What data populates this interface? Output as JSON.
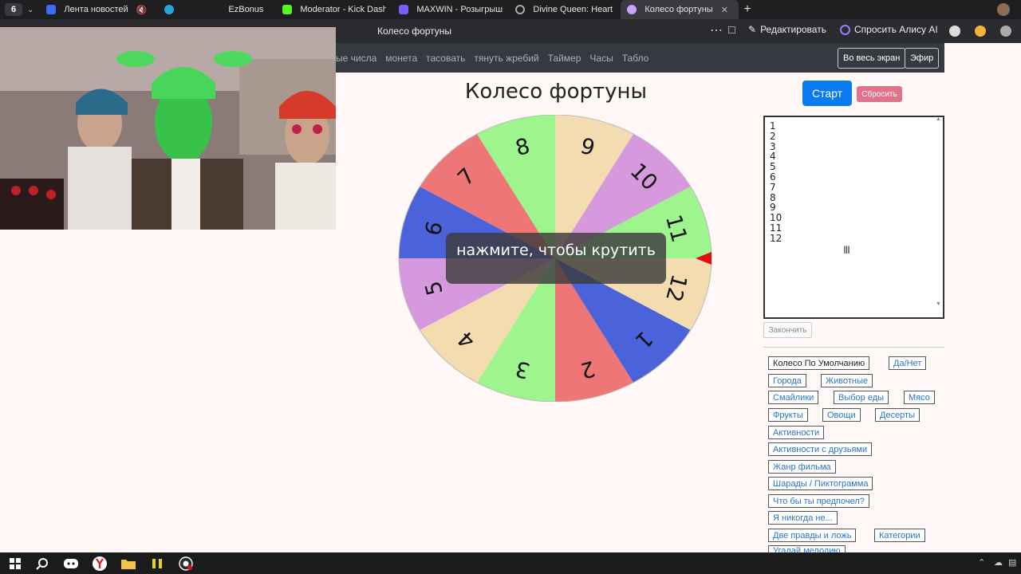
{
  "browser": {
    "tab_count": "6",
    "tabs": [
      {
        "label": "Лента новостей",
        "fav": "#3b6cff"
      },
      {
        "label": "",
        "fav": "#2aa3e0"
      },
      {
        "label": "EzBonus",
        "fav": ""
      },
      {
        "label": "Moderator - Kick Dashboa",
        "fav": "#53fc18"
      },
      {
        "label": "MAXWIN - Розыгрыш в ча",
        "fav": "#7b5cff"
      },
      {
        "label": "Divine Queen: Heart of Ice",
        "fav": "#aaaaaa"
      },
      {
        "label": "Колесо фортуны",
        "fav": "#c9a0ff"
      }
    ],
    "page_title": "Колесо фортуны",
    "edit_label": "Редактировать",
    "alice_label": "Спросить Алису AI"
  },
  "nav": {
    "links": [
      "ые числа",
      "монета",
      "тасовать",
      "тянуть жребий",
      "Таймер",
      "Часы",
      "Табло"
    ],
    "fullscreen_label": "Во весь экран",
    "broadcast_label": "Эфир"
  },
  "main": {
    "title": "Колесо фортуны",
    "start_label": "Старт",
    "reset_label": "Сбросить",
    "spin_hint": "нажмите, чтобы крутить",
    "entries_text": "1\n2\n3\n4\n5\n6\n7\n8\n9\n10\n11\n12",
    "finish_label": "Закончить"
  },
  "wheel": {
    "segments": [
      {
        "label": "1",
        "color": "#4a62da"
      },
      {
        "label": "2",
        "color": "#ee7676"
      },
      {
        "label": "3",
        "color": "#9ef58e"
      },
      {
        "label": "4",
        "color": "#f3dcb0"
      },
      {
        "label": "5",
        "color": "#d799dd"
      },
      {
        "label": "6",
        "color": "#4a62da"
      },
      {
        "label": "7",
        "color": "#ee7676"
      },
      {
        "label": "8",
        "color": "#9ef58e"
      },
      {
        "label": "9",
        "color": "#f3dcb0"
      },
      {
        "label": "10",
        "color": "#d799dd"
      },
      {
        "label": "11",
        "color": "#9ef58e"
      },
      {
        "label": "12",
        "color": "#f3dcb0"
      }
    ],
    "pointer_color": "#e01010"
  },
  "presets": [
    "Колесо По Умолчанию",
    "Да/Нет",
    "Города",
    "Животные",
    "Смайлики",
    "Выбор еды",
    "Мясо",
    "Фрукты",
    "Овощи",
    "Десерты",
    "Активности",
    "Активности с друзьями",
    "Жанр фильма",
    "Шарады / Пиктограмма",
    "Что бы ты предпочел?",
    "Я никогда не...",
    "Две правды и ложь",
    "Категории",
    "Угадай мелодию"
  ]
}
